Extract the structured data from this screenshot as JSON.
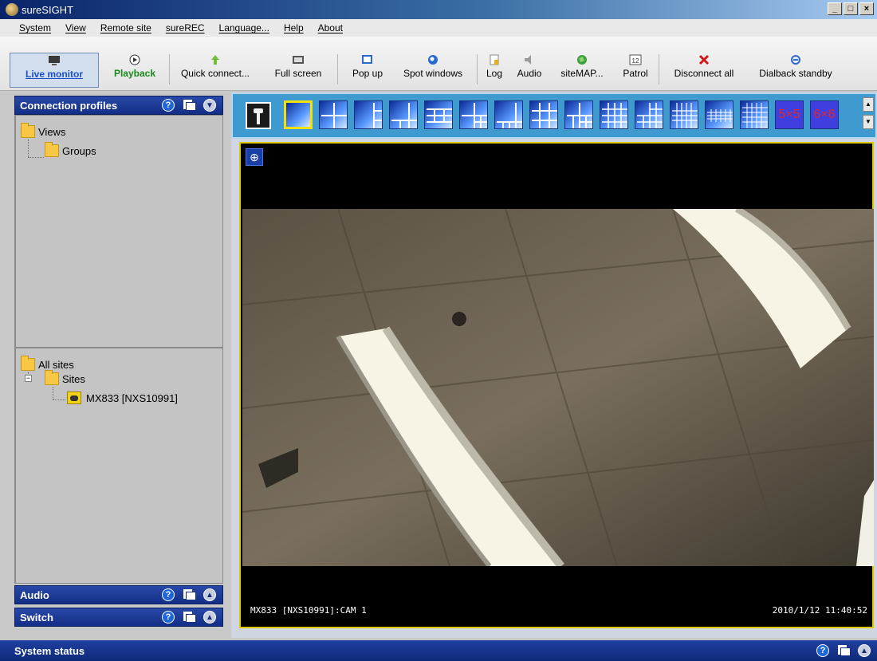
{
  "window": {
    "title": "sureSIGHT"
  },
  "menu": [
    "System",
    "View",
    "Remote site",
    "sureREC",
    "Language...",
    "Help",
    "About"
  ],
  "toolbar": {
    "live_monitor": "Live monitor",
    "playback": "Playback",
    "quick_connect": "Quick connect...",
    "full_screen": "Full screen",
    "pop_up": "Pop up",
    "spot_windows": "Spot windows",
    "log": "Log",
    "audio": "Audio",
    "sitemap": "siteMAP...",
    "patrol": "Patrol",
    "disconnect_all": "Disconnect all",
    "dialback_standby": "Dialback standby"
  },
  "panels": {
    "connection_profiles": "Connection profiles",
    "audio": "Audio",
    "switch": "Switch",
    "system_status": "System status"
  },
  "tree_top": {
    "views": "Views",
    "groups": "Groups"
  },
  "tree_bottom": {
    "all_sites": "All sites",
    "sites": "Sites",
    "camera": "MX833 [NXS10991]"
  },
  "layouts": {
    "five": "5×5",
    "six": "6×6"
  },
  "video": {
    "camera_label": "MX833 [NXS10991]:CAM 1",
    "timestamp": "2010/1/12  11:40:52"
  }
}
